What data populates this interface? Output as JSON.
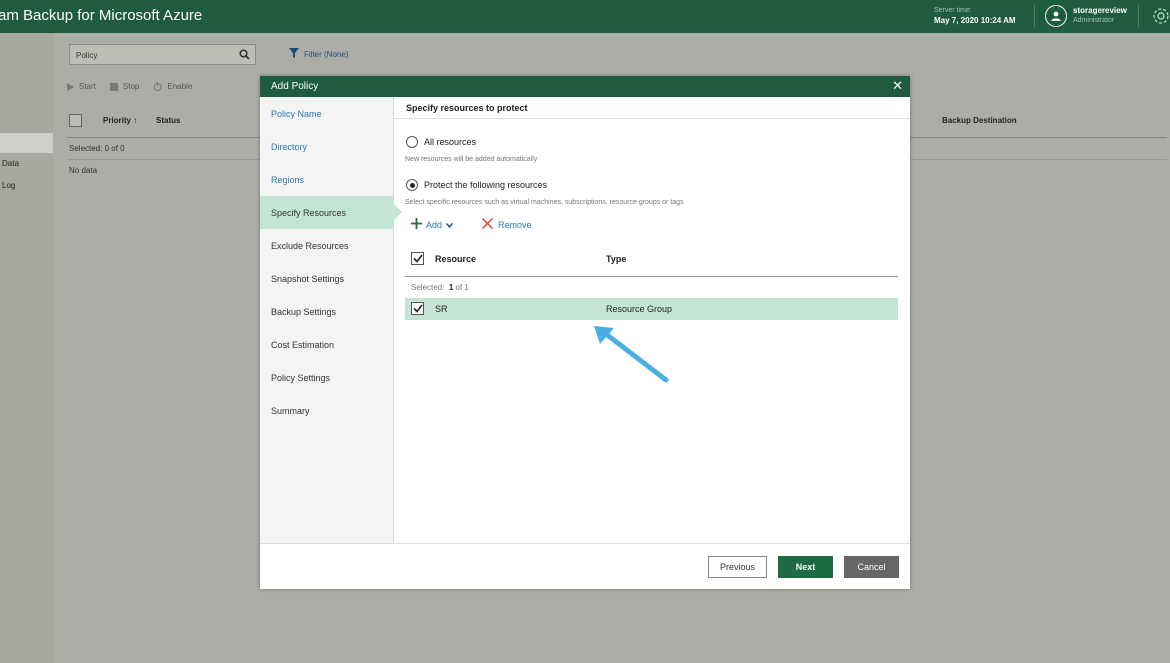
{
  "header": {
    "app_title": "am Backup for Microsoft Azure",
    "server_time_label": "Server time:",
    "server_time_value": "May 7, 2020 10:24 AM",
    "user_name": "storagereview",
    "user_role": "Administrator"
  },
  "leftnav": {
    "items": [
      "Data",
      "Log"
    ]
  },
  "background": {
    "search_value": "Policy",
    "filter_label": "Filter (None)",
    "toolbar": {
      "start": "Start",
      "stop": "Stop",
      "enable": "Enable"
    },
    "columns": {
      "priority": "Priority",
      "status": "Status",
      "backup_destination": "Backup Destination"
    },
    "selected": "Selected:  0 of 0",
    "no_data": "No data"
  },
  "modal": {
    "title": "Add Policy",
    "steps": [
      "Policy Name",
      "Directory",
      "Regions",
      "Specify Resources",
      "Exclude Resources",
      "Snapshot Settings",
      "Backup Settings",
      "Cost Estimation",
      "Policy Settings",
      "Summary"
    ],
    "active_step_index": 3,
    "panel_title": "Specify resources to protect",
    "option_all": "All resources",
    "option_all_hint": "New resources will be added automatically",
    "option_following": "Protect the following resources",
    "option_following_hint": "Select specific resources such as virtual machines, subscriptions, resource groups or tags",
    "selected_option": "following",
    "add_label": "Add",
    "remove_label": "Remove",
    "table": {
      "col_resource": "Resource",
      "col_type": "Type",
      "selected_prefix": "Selected:",
      "selected_count": "1",
      "selected_suffix": "of 1",
      "rows": [
        {
          "resource": "SR",
          "type": "Resource Group",
          "checked": true
        }
      ]
    },
    "buttons": {
      "previous": "Previous",
      "next": "Next",
      "cancel": "Cancel"
    }
  },
  "colors": {
    "brand_green": "#1f5c3f",
    "selection_green": "#c4e5d6",
    "link_blue": "#2b7bb5",
    "arrow_blue": "#4aaee0"
  }
}
